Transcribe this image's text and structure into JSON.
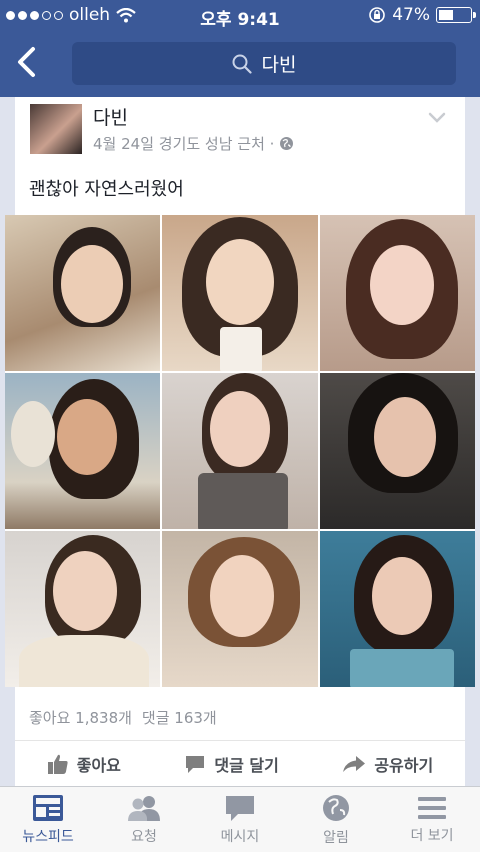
{
  "status_bar": {
    "carrier": "olleh",
    "time": "오후 9:41",
    "battery": "47%",
    "battery_level": 0.47
  },
  "nav": {
    "back_icon": "chevron-left-icon",
    "search_query": "다빈",
    "search_icon": "search-icon"
  },
  "post": {
    "author": "다빈",
    "meta": "4월 24일 경기도 성남 근처 ·",
    "privacy_icon": "globe-icon",
    "text": "괜찮아 자연스러웠어",
    "likes": "좋아요 1,838개",
    "comments": "댓글 163개",
    "actions": [
      {
        "label": "좋아요",
        "icon": "thumbs-up-icon"
      },
      {
        "label": "댓글 달기",
        "icon": "comment-icon"
      },
      {
        "label": "공유하기",
        "icon": "share-icon"
      }
    ]
  },
  "tabs": [
    {
      "label": "뉴스피드",
      "icon": "news-feed-icon",
      "active": true
    },
    {
      "label": "요청",
      "icon": "friend-requests-icon",
      "active": false
    },
    {
      "label": "메시지",
      "icon": "messages-icon",
      "active": false
    },
    {
      "label": "알림",
      "icon": "globe-notifications-icon",
      "active": false
    },
    {
      "label": "더 보기",
      "icon": "menu-icon",
      "active": false
    }
  ],
  "colors": {
    "brand": "#3b5998",
    "search_bg": "#2f4b86",
    "muted_text": "#90949c"
  }
}
